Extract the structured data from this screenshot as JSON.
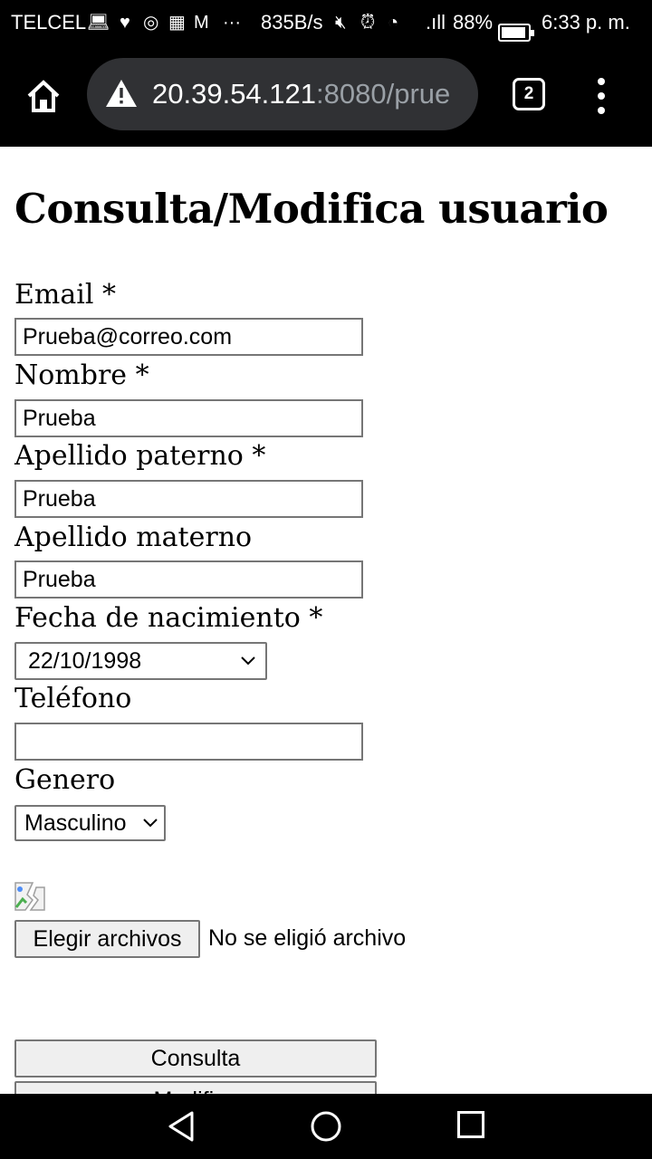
{
  "status_bar": {
    "carrier": "TELCEL",
    "net_speed": "835B/s",
    "signal": ".ıll",
    "battery_percent": "88%",
    "time": "6:33 p. m.",
    "icons": [
      "laptop-icon",
      "heart-icon",
      "whatsapp-icon",
      "calendar-icon",
      "gmail-icon",
      "more-icon",
      "mute-icon",
      "alarm-icon",
      "wifi-icon",
      "signal-icon",
      "battery-icon"
    ]
  },
  "browser": {
    "url_host": "20.39.54.121",
    "url_rest": ":8080/prue",
    "tab_count": "2",
    "icons": [
      "home-icon",
      "warning-icon",
      "tabs-icon",
      "overflow-menu-icon"
    ]
  },
  "form": {
    "title": "Consulta/Modifica usuario",
    "email": {
      "label": "Email *",
      "value": "Prueba@correo.com"
    },
    "nombre": {
      "label": "Nombre *",
      "value": "Prueba"
    },
    "apellido_paterno": {
      "label": "Apellido paterno *",
      "value": "Prueba"
    },
    "apellido_materno": {
      "label": "Apellido materno",
      "value": "Prueba"
    },
    "fecha_nacimiento": {
      "label": "Fecha de nacimiento *",
      "value": "22/10/1998"
    },
    "telefono": {
      "label": "Teléfono",
      "value": ""
    },
    "genero": {
      "label": "Genero",
      "value": "Masculino"
    },
    "file": {
      "button_label": "Elegir archivos",
      "status": "No se eligió archivo"
    },
    "consulta_button": "Consulta",
    "modifica_button": "Modifica"
  },
  "nav_bar": {
    "icons": [
      "back-icon",
      "home-circle-icon",
      "recents-icon"
    ]
  }
}
